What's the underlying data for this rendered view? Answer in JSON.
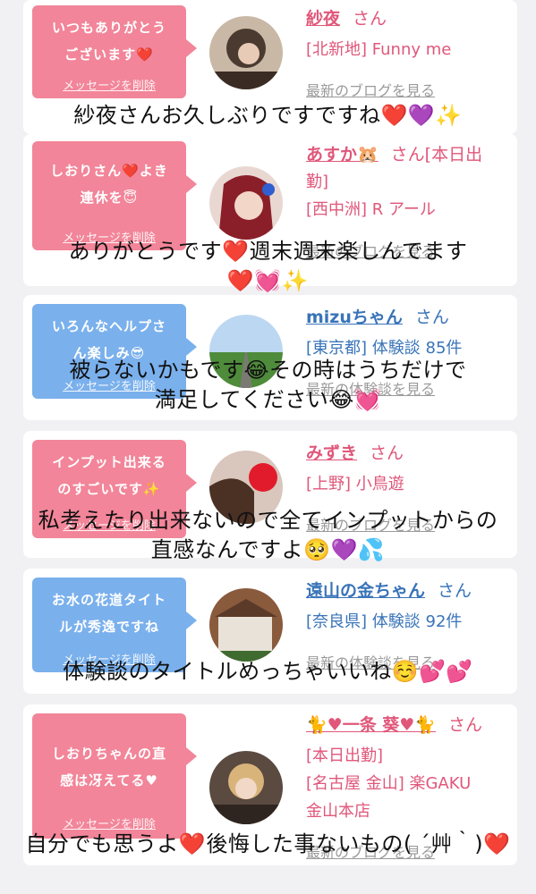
{
  "cards": [
    {
      "bubble_text": "いつもありがとう\nございます❤️",
      "bubble_color": "#f28599",
      "delete_label": "メッセージを削除",
      "name": "紗夜",
      "honorific": "さん",
      "meta": [
        "[北新地] Funny me"
      ],
      "more_link": "最新のブログを見る",
      "caption": "紗夜さんお久しぶりですですね❤️💜✨"
    },
    {
      "bubble_text": "しおりさん❤️よき\n連休を😇",
      "bubble_color": "#f28599",
      "delete_label": "メッセージを削除",
      "name": "あすか🐹",
      "honorific": "さん[本日出",
      "meta": [
        "勤]",
        "[西中洲] R アール"
      ],
      "more_link": "最新のブログを見る",
      "caption": "ありがとうです❤️週末週末楽しんでます\n❤️💓✨"
    },
    {
      "bubble_text": "いろんなヘルプさ\nん楽しみ😎",
      "bubble_color": "#7ab0ec",
      "delete_label": "メッセージを削除",
      "name": "mizuちゃん",
      "honorific": "さん",
      "meta": [
        "[東京都] 体験談 85件"
      ],
      "more_link": "最新の体験談を見る",
      "caption": "被らないかもです😂その時はうちだけで\n満足してください😂💓"
    },
    {
      "bubble_text": "インプット出来る\nのすごいです✨",
      "bubble_color": "#f28599",
      "delete_label": "メッセージを削除",
      "name": "みずき",
      "honorific": "さん",
      "meta": [
        "[上野] 小鳥遊"
      ],
      "more_link": "最新のブログを見る",
      "caption": "私考えたり出来ないので全てインプットからの\n直感なんですよ🥺💜💦"
    },
    {
      "bubble_text": "お水の花道タイト\nルが秀逸ですね",
      "bubble_color": "#7ab0ec",
      "delete_label": "メッセージを削除",
      "name": "遠山の金ちゃん",
      "honorific": "さん",
      "meta": [
        "[奈良県] 体験談 92件"
      ],
      "more_link": "最新の体験談を見る",
      "caption": "体験談のタイトルめっちゃいいね☺️💕💕"
    },
    {
      "bubble_text": "しおりちゃんの直\n感は冴えてる♥",
      "bubble_color": "#f28599",
      "delete_label": "メッセージを削除",
      "name": "🐈♥一条 葵♥🐈",
      "honorific": "さん",
      "meta": [
        "[本日出勤]",
        "[名古屋 金山] 楽GAKU",
        "金山本店"
      ],
      "more_link": "最新のブログを見る",
      "caption": "自分でも思うよ❤️後悔した事ないもの( ´艸｀)❤️"
    }
  ]
}
